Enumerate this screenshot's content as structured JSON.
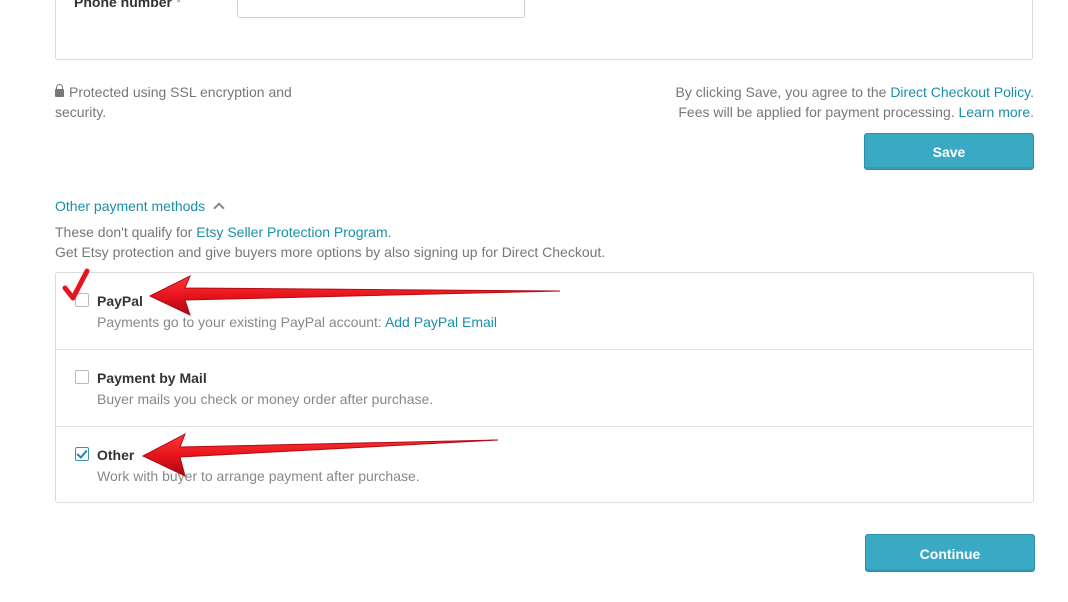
{
  "form": {
    "phone_label": "Phone number",
    "phone_required_mark": "*",
    "phone_value": ""
  },
  "security": {
    "ssl_text": "Protected using SSL encryption and security."
  },
  "policy": {
    "line1_prefix": "By clicking Save, you agree to the ",
    "line1_link": "Direct Checkout Policy",
    "line1_suffix": ".",
    "line2_prefix": "Fees will be applied for payment processing. ",
    "line2_link": "Learn more",
    "line2_suffix": "."
  },
  "buttons": {
    "save": "Save",
    "continue": "Continue"
  },
  "other_methods": {
    "toggle_label": "Other payment methods",
    "qualify_prefix": "These don't qualify for ",
    "qualify_link": "Etsy Seller Protection Program",
    "qualify_suffix": ".",
    "protection_text": "Get Etsy protection and give buyers more options by also signing up for Direct Checkout."
  },
  "methods": [
    {
      "title": "PayPal",
      "desc_prefix": "Payments go to your existing PayPal account: ",
      "desc_link": "Add PayPal Email",
      "checked": false
    },
    {
      "title": "Payment by Mail",
      "desc_prefix": "Buyer mails you check or money order after purchase.",
      "desc_link": "",
      "checked": false
    },
    {
      "title": "Other",
      "desc_prefix": "Work with buyer to arrange payment after purchase.",
      "desc_link": "",
      "checked": true
    }
  ],
  "colors": {
    "accent": "#1a8fa8",
    "button": "#3aa9c4",
    "annotation": "#e8141c"
  }
}
